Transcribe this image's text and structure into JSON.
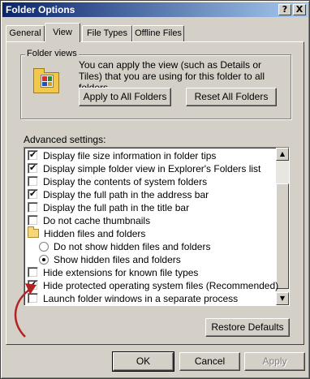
{
  "window": {
    "title": "Folder Options",
    "help_label": "?",
    "close_label": "X"
  },
  "tabs": [
    {
      "label": "General",
      "active": false
    },
    {
      "label": "View",
      "active": true
    },
    {
      "label": "File Types",
      "active": false
    },
    {
      "label": "Offline Files",
      "active": false
    }
  ],
  "folder_views": {
    "group_label": "Folder views",
    "description": "You can apply the view (such as Details or Tiles) that you are using for this folder to all folders.",
    "apply_button": "Apply to All Folders",
    "reset_button": "Reset All Folders",
    "icon": "folder-views-icon"
  },
  "advanced": {
    "label": "Advanced settings:",
    "items": [
      {
        "type": "checkbox",
        "checked": true,
        "label": "Display file size information in folder tips",
        "indent": 0
      },
      {
        "type": "checkbox",
        "checked": true,
        "label": "Display simple folder view in Explorer's Folders list",
        "indent": 0
      },
      {
        "type": "checkbox",
        "checked": false,
        "label": "Display the contents of system folders",
        "indent": 0
      },
      {
        "type": "checkbox",
        "checked": true,
        "label": "Display the full path in the address bar",
        "indent": 0
      },
      {
        "type": "checkbox",
        "checked": false,
        "label": "Display the full path in the title bar",
        "indent": 0
      },
      {
        "type": "checkbox",
        "checked": false,
        "label": "Do not cache thumbnails",
        "indent": 0
      },
      {
        "type": "folder",
        "checked": false,
        "label": "Hidden files and folders",
        "indent": 0
      },
      {
        "type": "radio",
        "checked": false,
        "label": "Do not show hidden files and folders",
        "indent": 1
      },
      {
        "type": "radio",
        "checked": true,
        "label": "Show hidden files and folders",
        "indent": 1
      },
      {
        "type": "checkbox",
        "checked": false,
        "label": "Hide extensions for known file types",
        "indent": 0
      },
      {
        "type": "checkbox",
        "checked": true,
        "label": "Hide protected operating system files (Recommended)",
        "indent": 0
      },
      {
        "type": "checkbox",
        "checked": false,
        "label": "Launch folder windows in a separate process",
        "indent": 0
      }
    ],
    "restore_button": "Restore Defaults"
  },
  "footer": {
    "ok": "OK",
    "cancel": "Cancel",
    "apply": "Apply"
  },
  "colors": {
    "titlebar_start": "#0a246a",
    "titlebar_end": "#a6caf0",
    "annotation_arrow": "#b22222",
    "dialog_face": "#d4d0c8"
  }
}
